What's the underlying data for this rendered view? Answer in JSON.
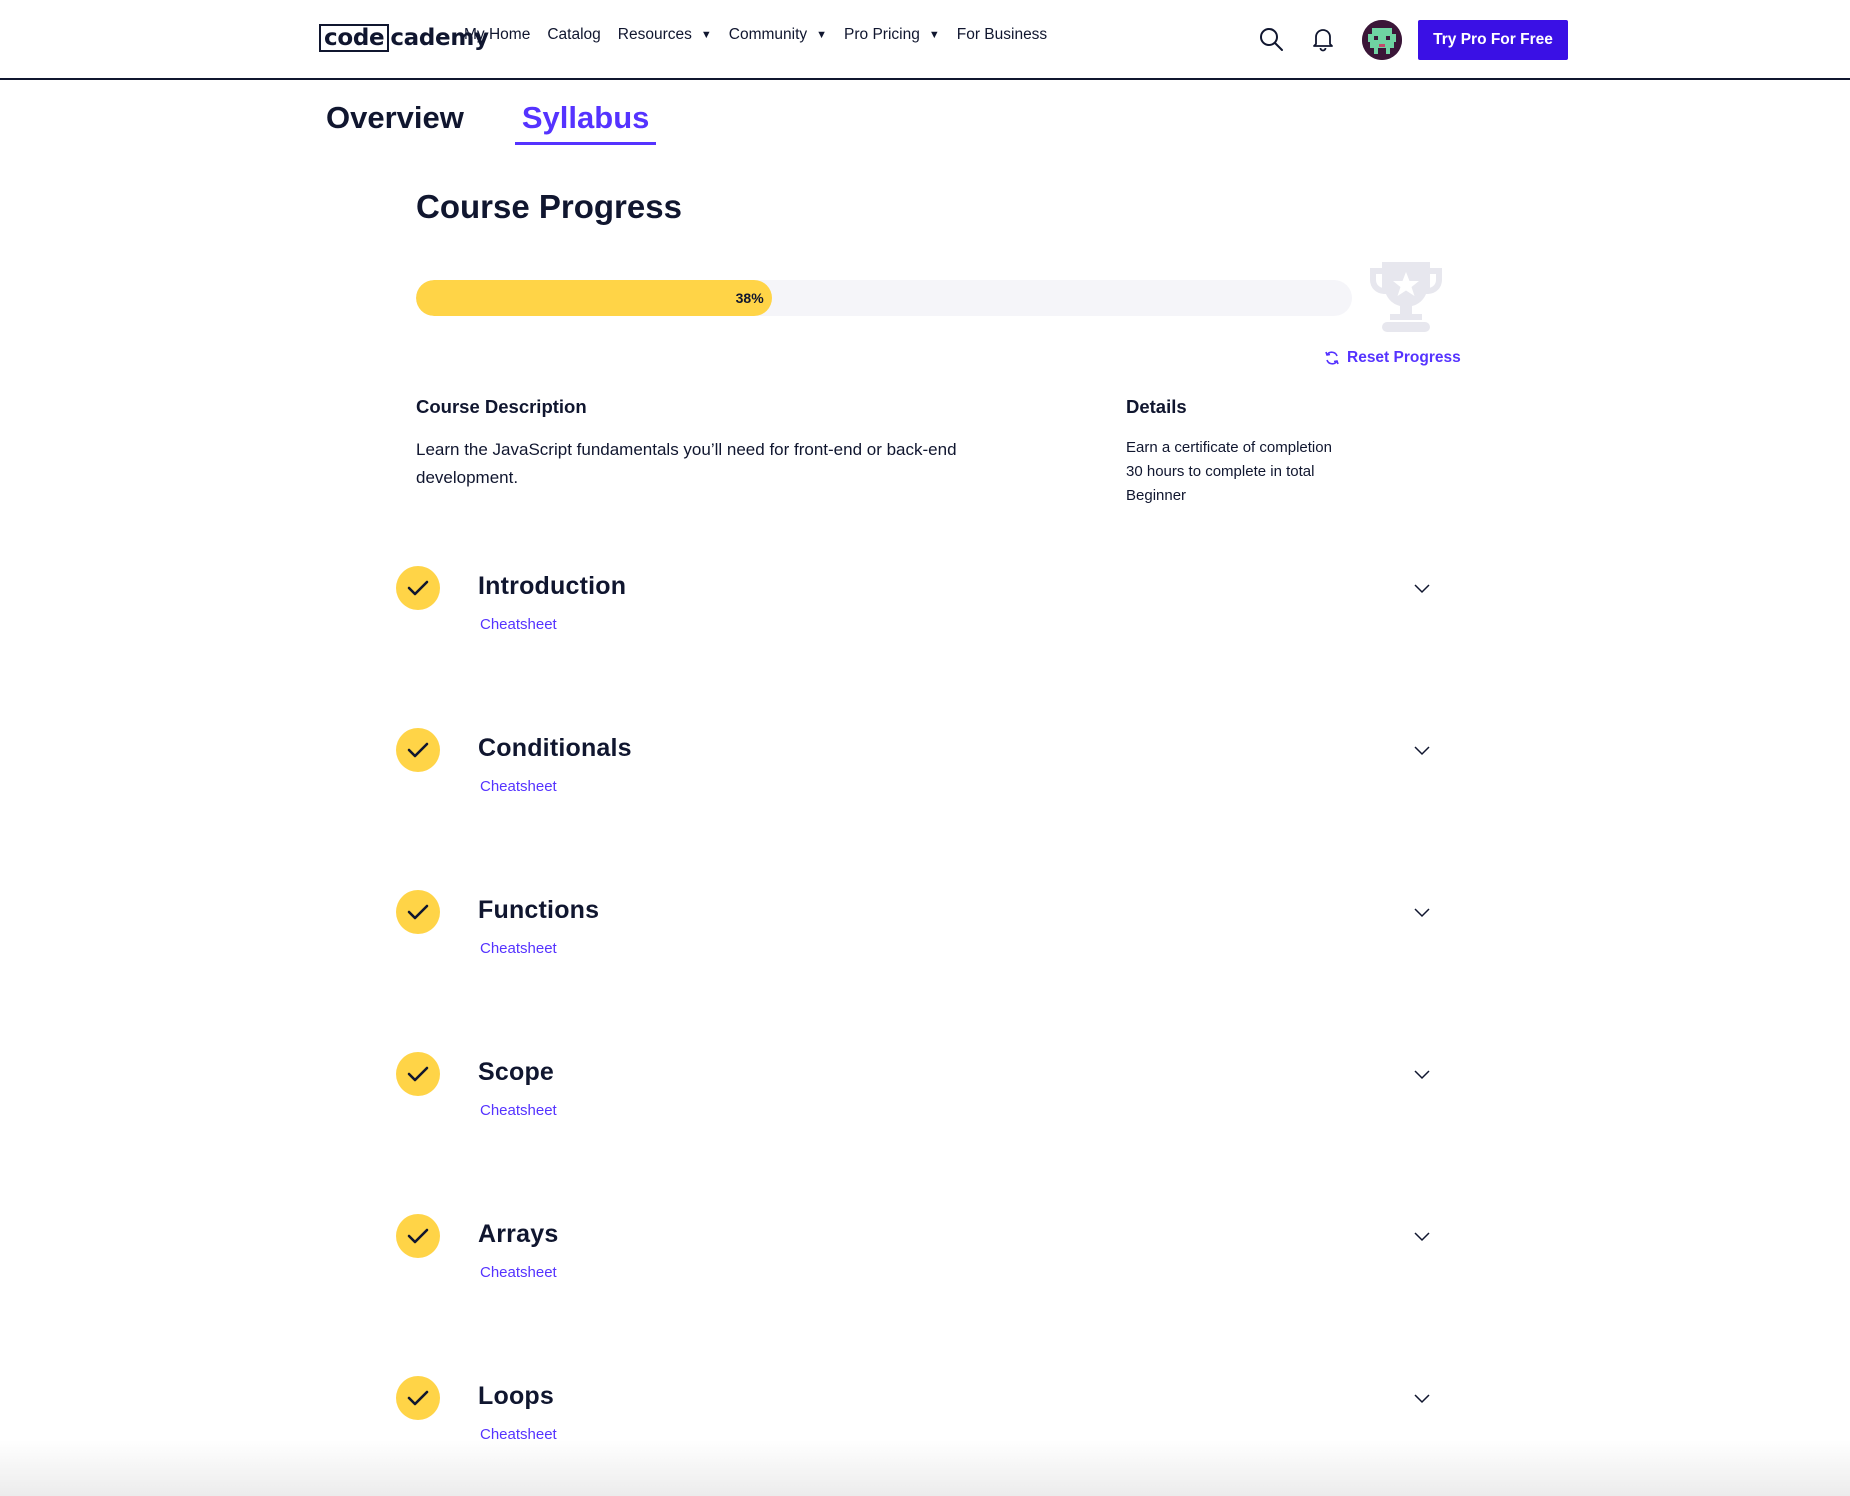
{
  "nav": {
    "logo_code": "code",
    "logo_cademy": "cademy",
    "links": [
      {
        "label": "My Home",
        "dropdown": false
      },
      {
        "label": "Catalog",
        "dropdown": false
      },
      {
        "label": "Resources",
        "dropdown": true
      },
      {
        "label": "Community",
        "dropdown": true
      },
      {
        "label": "Pro Pricing",
        "dropdown": true
      },
      {
        "label": "For Business",
        "dropdown": false
      }
    ],
    "caret": "▼",
    "cta_label": "Try Pro For Free",
    "icons": [
      "search-icon",
      "bell-icon",
      "avatar"
    ]
  },
  "tabs": [
    {
      "label": "Overview",
      "active": false
    },
    {
      "label": "Syllabus",
      "active": true
    }
  ],
  "progress": {
    "title": "Course Progress",
    "percent": 38,
    "percent_label": "38%",
    "reset_label": "Reset Progress"
  },
  "description": {
    "heading": "Course Description",
    "text": "Learn the JavaScript fundamentals you’ll need for front-end or back-end development."
  },
  "details": {
    "heading": "Details",
    "items": [
      "Earn a certificate of completion",
      "30 hours to complete in total",
      "Beginner"
    ]
  },
  "modules": [
    {
      "title": "Introduction",
      "link": "Cheatsheet",
      "completed": true
    },
    {
      "title": "Conditionals",
      "link": "Cheatsheet",
      "completed": true
    },
    {
      "title": "Functions",
      "link": "Cheatsheet",
      "completed": true
    },
    {
      "title": "Scope",
      "link": "Cheatsheet",
      "completed": true
    },
    {
      "title": "Arrays",
      "link": "Cheatsheet",
      "completed": true
    },
    {
      "title": "Loops",
      "link": "Cheatsheet",
      "completed": true
    }
  ],
  "colors": {
    "accent": "#5533ff",
    "cta": "#3a10e5",
    "progress": "#ffd447",
    "text": "#10162f"
  }
}
